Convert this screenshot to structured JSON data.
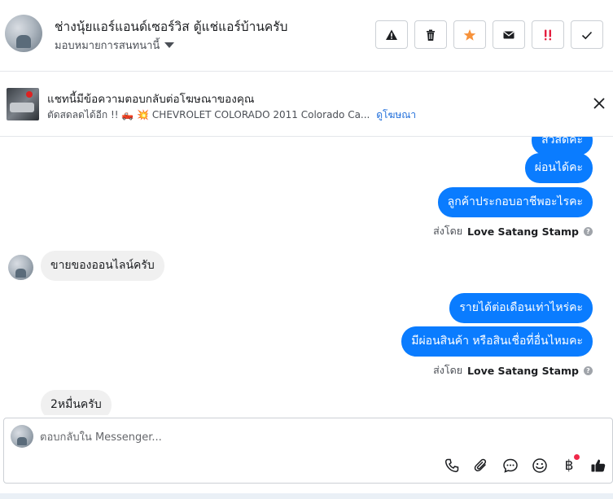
{
  "header": {
    "name": "ช่างนุ้ยแอร์แอนด์เซอร์วิส ตู้แช่แอร์บ้านครับ",
    "assign_label": "มอบหมายการสนทนานี้",
    "actions": [
      "warning-icon",
      "trash-icon",
      "star-icon",
      "envelope-icon",
      "double-exclamation-icon",
      "check-icon"
    ]
  },
  "ad": {
    "title": "แชทนี้มีข้อความตอบกลับต่อโฆษณาของคุณ",
    "description": "ตัดสดลดได้อีก !! 🛻 💥 CHEVROLET COLORADO 2011 Colorado Ca...",
    "link": "ดูโฆษณา"
  },
  "messages": {
    "out_partial": "สวัสดีค่ะ",
    "out_1": "ผ่อนได้คะ",
    "out_2": "ลูกค้าประกอบอาชีพอะไรคะ",
    "sent_by_prefix": "ส่งโดย",
    "sent_by_name": "Love Satang Stamp",
    "in_1": "ขายของออนไลน์ครับ",
    "out_3": "รายได้ต่อเดือนเท่าไหร่คะ",
    "out_4": "มีผ่อนสินค้า หรือสินเชื่อที่อื่นไหมคะ",
    "in_2": "2หมื่นครับ"
  },
  "composer": {
    "placeholder": "ตอบกลับใน Messenger...",
    "currency_symbol": "฿",
    "tools": [
      "phone-icon",
      "paperclip-icon",
      "saved-reply-icon",
      "emoji-icon",
      "baht-icon",
      "thumbs-up-icon"
    ]
  },
  "colors": {
    "outgoing_bubble": "#0a7cff",
    "incoming_bubble": "#f0f0f0",
    "star": "#f7923b",
    "urgent": "#e41e3f"
  }
}
